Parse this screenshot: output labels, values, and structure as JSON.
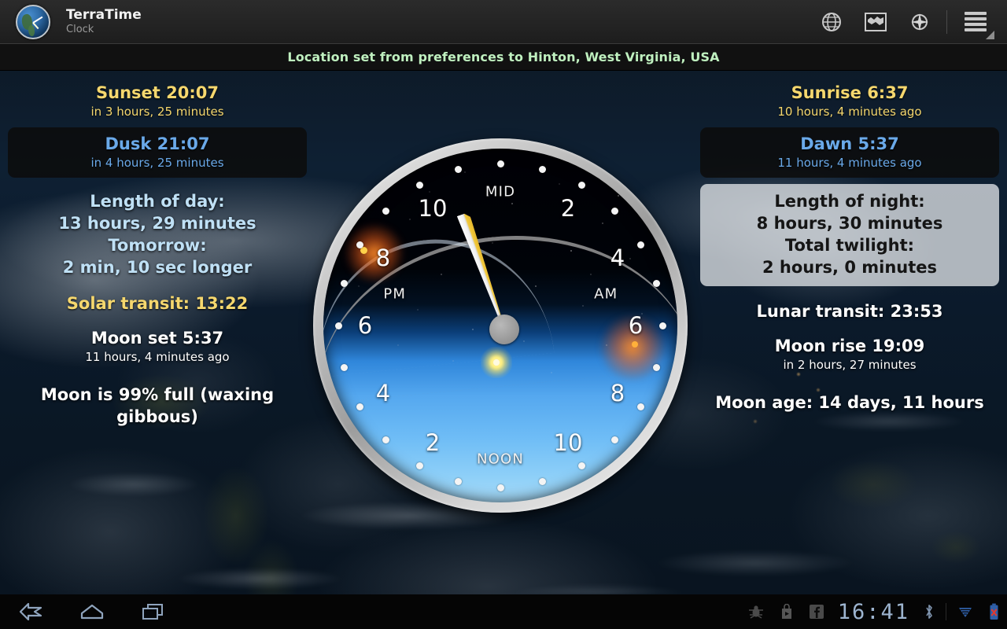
{
  "actionbar": {
    "app_title": "TerraTime",
    "app_subtitle": "Clock",
    "icons": [
      "globe-icon",
      "world-map-icon",
      "compass-icon",
      "overflow-menu-icon"
    ]
  },
  "location_banner": {
    "text": "Location set from preferences to Hinton, West Virginia, USA",
    "color": "#bff0bf"
  },
  "left_column": {
    "sunset": {
      "title": "Sunset 20:07",
      "detail": "in 3 hours, 25 minutes",
      "color": "#f5d76e"
    },
    "dusk": {
      "title": "Dusk 21:07",
      "detail": "in 4 hours, 25 minutes",
      "color": "#6aa9e9"
    },
    "length_of_day": {
      "label": "Length of day:",
      "value": "13 hours, 29 minutes",
      "tomorrow_label": "Tomorrow:",
      "tomorrow_value": "2 min, 10 sec longer",
      "color": "#bfe0f5"
    },
    "solar_transit": {
      "text": "Solar transit: 13:22",
      "color": "#f5d76e"
    },
    "moon_set": {
      "title": "Moon set 5:37",
      "detail": "11 hours, 4 minutes ago"
    },
    "moon_phase": {
      "text": "Moon is 99% full (waxing gibbous)"
    }
  },
  "right_column": {
    "sunrise": {
      "title": "Sunrise 6:37",
      "detail": "10 hours, 4 minutes ago",
      "color": "#f5d76e"
    },
    "dawn": {
      "title": "Dawn 5:37",
      "detail": "11 hours, 4 minutes ago",
      "color": "#6aa9e9"
    },
    "length_of_night": {
      "label": "Length of night:",
      "value": "8 hours, 30 minutes",
      "twilight_label": "Total twilight:",
      "twilight_value": "2 hours, 0 minutes"
    },
    "lunar_transit": {
      "text": "Lunar transit: 23:53"
    },
    "moon_rise": {
      "title": "Moon rise 19:09",
      "detail": "in 2 hours, 27 minutes"
    },
    "moon_age": {
      "text": "Moon age: 14 days, 11 hours"
    }
  },
  "clock": {
    "type": "24-hour-dial",
    "numerals": [
      "2",
      "4",
      "6",
      "8",
      "10",
      "2",
      "4",
      "6",
      "8",
      "10"
    ],
    "label_midnight": "MID",
    "label_noon": "NOON",
    "label_am": "AM",
    "label_pm": "PM",
    "current_time": "16:41",
    "hand_angle_deg": 250.25,
    "sun_marker": "sun-icon",
    "sunset_marker_hour": 20.12,
    "sunrise_marker_hour": 6.62
  },
  "system_bar": {
    "nav": [
      "back-icon",
      "home-icon",
      "recents-icon"
    ],
    "tray": [
      "debug-bug-icon",
      "play-store-icon",
      "facebook-icon"
    ],
    "clock": "16:41",
    "status": [
      "bluetooth-icon",
      "wifi-icon",
      "battery-error-icon"
    ]
  }
}
